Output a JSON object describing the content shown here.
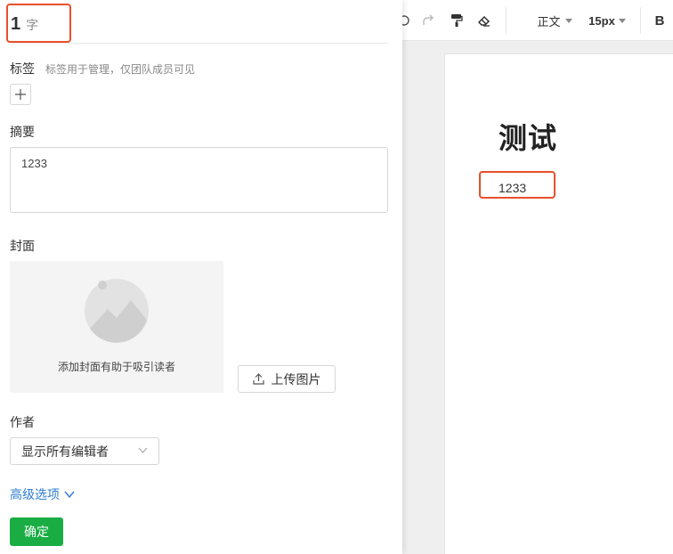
{
  "word_count": {
    "number": "1",
    "unit": "字"
  },
  "tags": {
    "label": "标签",
    "hint": "标签用于管理，仅团队成员可见",
    "add_symbol": "+"
  },
  "summary": {
    "label": "摘要",
    "value": "1233"
  },
  "cover": {
    "label": "封面",
    "hint": "添加封面有助于吸引读者",
    "upload_label": "上传图片"
  },
  "author": {
    "label": "作者",
    "selected": "显示所有编辑者"
  },
  "advanced": {
    "label": "高级选项"
  },
  "confirm": {
    "label": "确定"
  },
  "toolbar": {
    "style_label": "正文",
    "size_label": "15px",
    "bold_label": "B"
  },
  "document": {
    "title": "测试",
    "body": "1233"
  },
  "colors": {
    "accent_green": "#1aad43",
    "link_blue": "#2e7dd1",
    "highlight_red": "#e8502a"
  }
}
